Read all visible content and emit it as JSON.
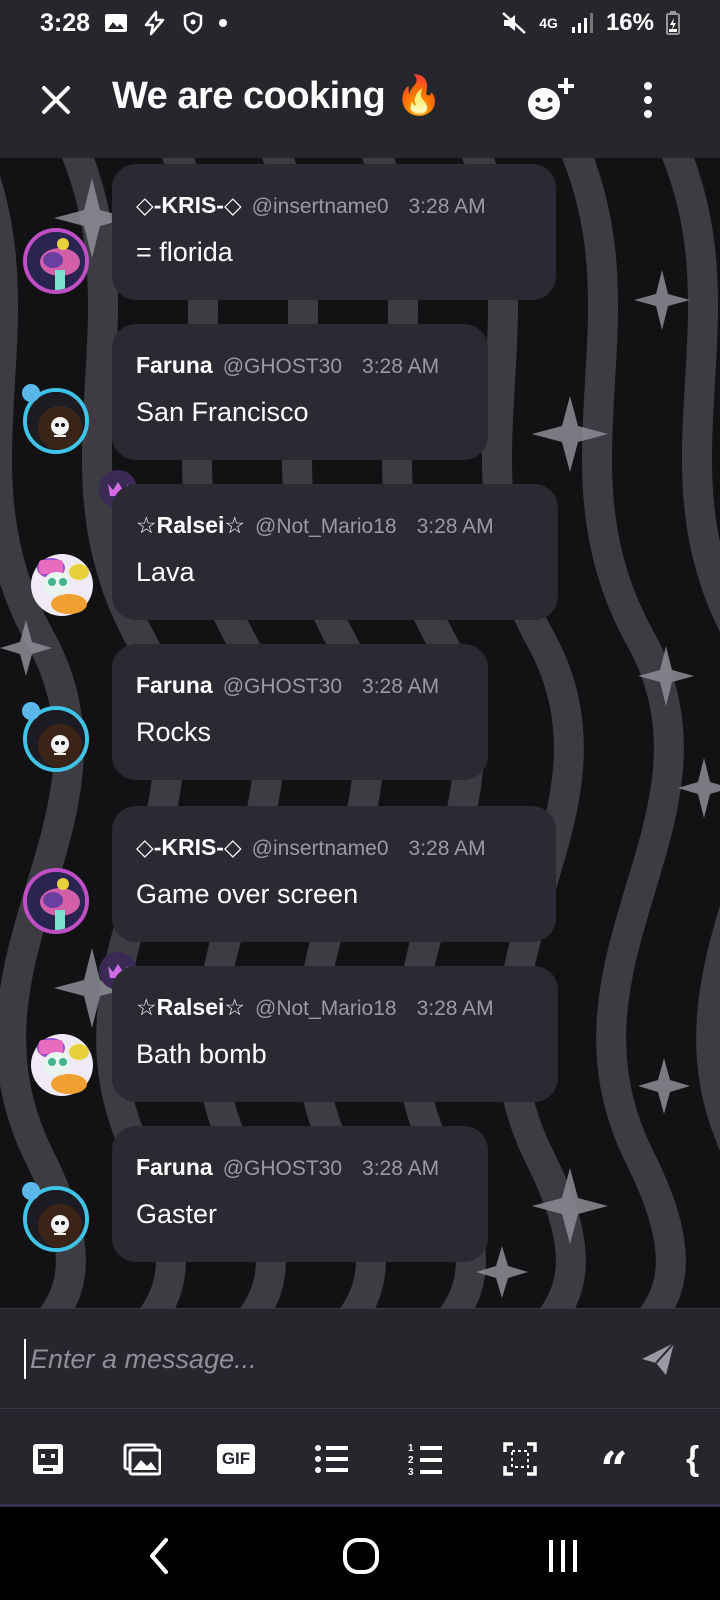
{
  "status_bar": {
    "time": "3:28",
    "network": "4G",
    "battery": "16%"
  },
  "header": {
    "title": "We are cooking 🔥"
  },
  "composer": {
    "placeholder": "Enter a message..."
  },
  "toolbar": {
    "gif_label": "GIF",
    "quote_glyph": "“",
    "brace_glyph": "{"
  },
  "messages": [
    {
      "name": "◇-KRIS-◇",
      "handle": "@insertname0",
      "time": "3:28 AM",
      "text": "= florida"
    },
    {
      "name": "Faruna",
      "handle": "@GHOST30",
      "time": "3:28 AM",
      "text": "San Francisco"
    },
    {
      "name": "☆Ralsei☆",
      "handle": "@Not_Mario18",
      "time": "3:28 AM",
      "text": "Lava"
    },
    {
      "name": "Faruna",
      "handle": "@GHOST30",
      "time": "3:28 AM",
      "text": "Rocks"
    },
    {
      "name": "◇-KRIS-◇",
      "handle": "@insertname0",
      "time": "3:28 AM",
      "text": "Game over screen"
    },
    {
      "name": "☆Ralsei☆",
      "handle": "@Not_Mario18",
      "time": "3:28 AM",
      "text": "Bath bomb"
    },
    {
      "name": "Faruna",
      "handle": "@GHOST30",
      "time": "3:28 AM",
      "text": "Gaster"
    }
  ],
  "colors": {
    "bar_bg": "#26262d",
    "bubble_bg": "#2b2a33",
    "muted_text": "#9a99a4",
    "crown": "#d46be6",
    "ring_blue": "#3fc4e8",
    "ring_pink": "#c04fc5"
  },
  "icons": {
    "close": "close-icon",
    "add_member": "add-member-icon",
    "more": "more-vertical-icon",
    "send": "send-icon",
    "sticker": "sticker-icon",
    "image": "image-icon",
    "bullet_list": "bullet-list-icon",
    "numbered_list": "numbered-list-icon",
    "spoiler": "spoiler-icon",
    "quote": "quote-icon",
    "code": "code-icon",
    "back": "back-icon",
    "home": "home-icon",
    "recents": "recents-icon"
  }
}
